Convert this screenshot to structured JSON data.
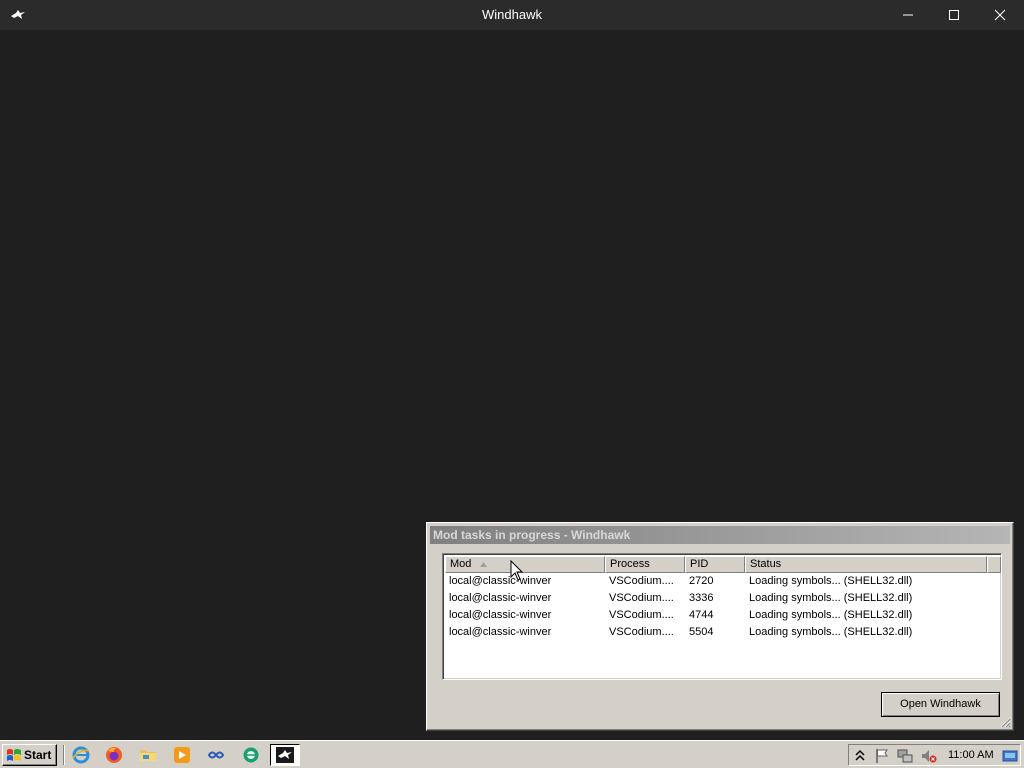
{
  "window": {
    "title": "Windhawk",
    "app_icon": "windhawk-bird-icon",
    "controls": {
      "minimize": "minimize-icon",
      "maximize": "maximize-icon",
      "close": "close-icon"
    }
  },
  "dialog": {
    "title": "Mod tasks in progress - Windhawk",
    "columns": {
      "mod": "Mod",
      "process": "Process",
      "pid": "PID",
      "status": "Status"
    },
    "sorted_column": "Mod",
    "sort_direction": "ascending",
    "rows": [
      {
        "mod": "local@classic-winver",
        "process": "VSCodium....",
        "pid": "2720",
        "status": "Loading symbols... (SHELL32.dll)"
      },
      {
        "mod": "local@classic-winver",
        "process": "VSCodium....",
        "pid": "3336",
        "status": "Loading symbols... (SHELL32.dll)"
      },
      {
        "mod": "local@classic-winver",
        "process": "VSCodium....",
        "pid": "4744",
        "status": "Loading symbols... (SHELL32.dll)"
      },
      {
        "mod": "local@classic-winver",
        "process": "VSCodium....",
        "pid": "5504",
        "status": "Loading symbols... (SHELL32.dll)"
      }
    ],
    "open_button": "Open Windhawk"
  },
  "taskbar": {
    "start_label": "Start",
    "quick_launch": [
      "internet-explorer-icon",
      "firefox-icon",
      "file-explorer-icon",
      "media-player-icon",
      "vscodium-icon",
      "network-globe-icon"
    ],
    "active_window_icon": "windhawk-bird-icon",
    "tray_icons": [
      "show-hidden-icons-chevron-icon",
      "action-center-flag-icon",
      "network-icon",
      "volume-muted-icon"
    ],
    "clock": "11:00 AM",
    "show_desktop_icon": "show-desktop-icon"
  },
  "colors": {
    "desktop_bg": "#1f1f1f",
    "titlebar_bg": "#2b2b2b",
    "classic_face": "#d4d0c8",
    "dialog_title_inactive": "#808080"
  }
}
